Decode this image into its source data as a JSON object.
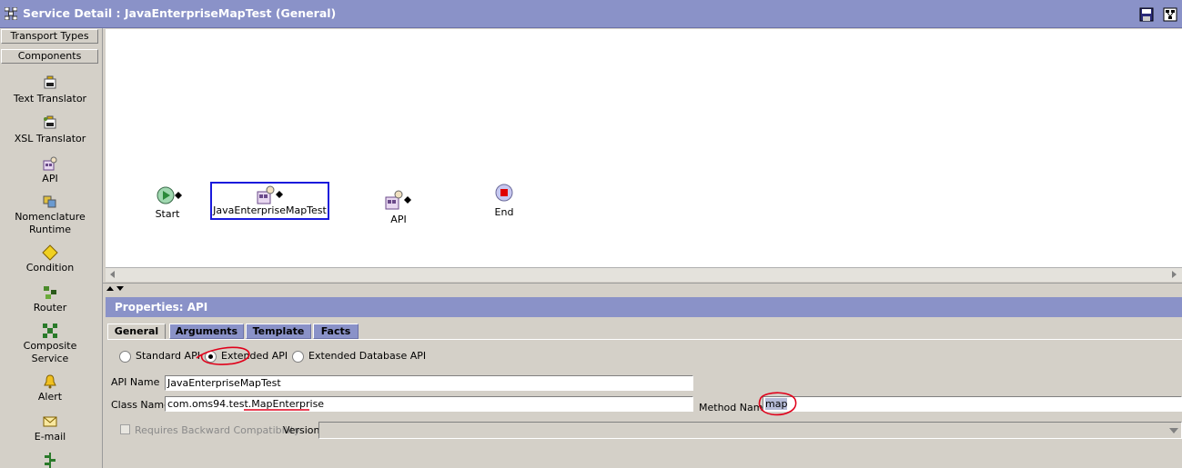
{
  "window": {
    "title": "Service Detail : JavaEnterpriseMapTest (General)",
    "title_icon": "workflow-icon",
    "save_icon": "save-icon",
    "layout_icon": "layout-icon"
  },
  "palette": {
    "sections": [
      {
        "label": "Transport Types"
      },
      {
        "label": "Components"
      }
    ],
    "items": [
      {
        "label": "Text Translator",
        "icon": "text-translator-icon"
      },
      {
        "label": "XSL Translator",
        "icon": "xsl-translator-icon"
      },
      {
        "label": "API",
        "icon": "api-icon"
      },
      {
        "label": "Nomenclature Runtime",
        "line1": "Nomenclature",
        "line2": "Runtime",
        "icon": "nomenclature-icon"
      },
      {
        "label": "Condition",
        "icon": "condition-icon"
      },
      {
        "label": "Router",
        "icon": "router-icon"
      },
      {
        "label": "Composite Service",
        "line1": "Composite",
        "line2": "Service",
        "icon": "composite-service-icon"
      },
      {
        "label": "Alert",
        "icon": "alert-icon"
      },
      {
        "label": "E-mail",
        "icon": "email-icon"
      }
    ]
  },
  "canvas": {
    "nodes": [
      {
        "label": "Start",
        "icon": "start-icon"
      },
      {
        "label": "JavaEnterpriseMapTest",
        "icon": "api-icon",
        "selected": true
      },
      {
        "label": "API",
        "icon": "api-icon"
      },
      {
        "label": "End",
        "icon": "end-icon"
      }
    ]
  },
  "properties": {
    "header": "Properties: API",
    "tabs": [
      {
        "label": "General",
        "active": true
      },
      {
        "label": "Arguments"
      },
      {
        "label": "Template"
      },
      {
        "label": "Facts"
      }
    ],
    "api_types": [
      {
        "label": "Standard API",
        "selected": false
      },
      {
        "label": "Extended API",
        "selected": true
      },
      {
        "label": "Extended Database API",
        "selected": false
      }
    ],
    "api_name": {
      "label": "API Name",
      "value": "JavaEnterpriseMapTest"
    },
    "class_name": {
      "label": "Class Name",
      "value": "com.oms94.test.MapEnterprise"
    },
    "method_name": {
      "label": "Method Name",
      "value": "map"
    },
    "backward_compat": {
      "label": "Requires Backward Compatibility",
      "checked": false
    },
    "version": {
      "label": "Version",
      "value": ""
    }
  },
  "colors": {
    "title_bar": "#8a92c8",
    "panel": "#d4d0c8",
    "selection_border": "#1a1adc",
    "annotation": "#e0001a"
  }
}
